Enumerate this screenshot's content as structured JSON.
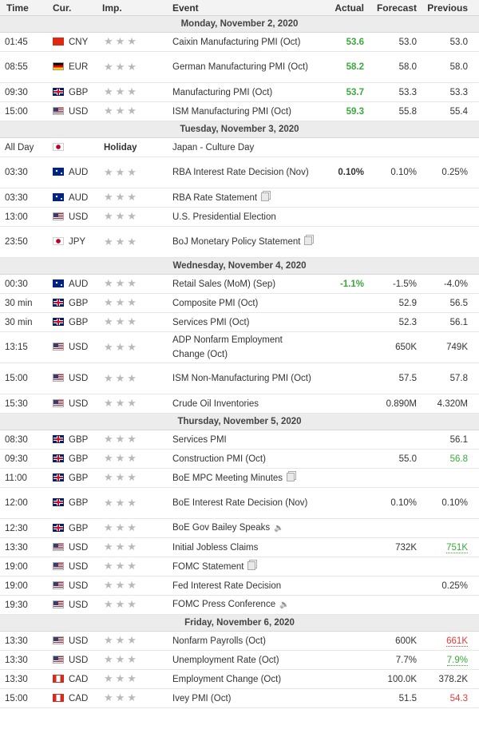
{
  "header": {
    "time": "Time",
    "currency": "Cur.",
    "importance": "Imp.",
    "event": "Event",
    "actual": "Actual",
    "forecast": "Forecast",
    "previous": "Previous"
  },
  "stars": "★★★",
  "colors": {
    "positive": "#3aa93a",
    "negative": "#e23b3b",
    "day_row_bg": "#ececec",
    "header_bg": "#f3f3f3"
  },
  "days": [
    {
      "label": "Monday, November 2, 2020",
      "events": [
        {
          "time": "01:45",
          "flag": "cn",
          "currency": "CNY",
          "event": "Caixin Manufacturing PMI (Oct)",
          "actual": "53.6",
          "actual_color": "green",
          "forecast": "53.0",
          "previous": "53.0"
        },
        {
          "time": "08:55",
          "flag": "de",
          "currency": "EUR",
          "event": "German Manufacturing PMI (Oct)",
          "actual": "58.2",
          "actual_color": "green",
          "forecast": "58.0",
          "previous": "58.0",
          "tall": true
        },
        {
          "time": "09:30",
          "flag": "gb",
          "currency": "GBP",
          "event": "Manufacturing PMI (Oct)",
          "actual": "53.7",
          "actual_color": "green",
          "forecast": "53.3",
          "previous": "53.3"
        },
        {
          "time": "15:00",
          "flag": "us",
          "currency": "USD",
          "event": "ISM Manufacturing PMI (Oct)",
          "actual": "59.3",
          "actual_color": "green",
          "forecast": "55.8",
          "previous": "55.4"
        }
      ]
    },
    {
      "label": "Tuesday, November 3, 2020",
      "events": [
        {
          "time": "All Day",
          "flag": "jp",
          "currency": "",
          "holiday": "Holiday",
          "event": "Japan - Culture Day",
          "actual": "",
          "forecast": "",
          "previous": ""
        },
        {
          "time": "03:30",
          "flag": "au",
          "currency": "AUD",
          "event": "RBA Interest Rate Decision (Nov)",
          "actual": "0.10%",
          "actual_color": "",
          "forecast": "0.10%",
          "previous": "0.25%",
          "tall": true
        },
        {
          "time": "03:30",
          "flag": "au",
          "currency": "AUD",
          "event": "RBA Rate Statement",
          "icon": "doc",
          "actual": "",
          "forecast": "",
          "previous": ""
        },
        {
          "time": "13:00",
          "flag": "us",
          "currency": "USD",
          "event": "U.S. Presidential Election",
          "actual": "",
          "forecast": "",
          "previous": ""
        },
        {
          "time": "23:50",
          "flag": "jp",
          "currency": "JPY",
          "event": "BoJ Monetary Policy Statement",
          "icon": "doc",
          "actual": "",
          "forecast": "",
          "previous": "",
          "tall": true
        }
      ]
    },
    {
      "label": "Wednesday, November 4, 2020",
      "events": [
        {
          "time": "00:30",
          "flag": "au",
          "currency": "AUD",
          "event": "Retail Sales (MoM) (Sep)",
          "actual": "-1.1%",
          "actual_color": "green",
          "forecast": "-1.5%",
          "previous": "-4.0%"
        },
        {
          "time": "30 min",
          "flag": "gb",
          "currency": "GBP",
          "event": "Composite PMI (Oct)",
          "actual": "",
          "forecast": "52.9",
          "previous": "56.5"
        },
        {
          "time": "30 min",
          "flag": "gb",
          "currency": "GBP",
          "event": "Services PMI (Oct)",
          "actual": "",
          "forecast": "52.3",
          "previous": "56.1"
        },
        {
          "time": "13:15",
          "flag": "us",
          "currency": "USD",
          "event": "ADP Nonfarm Employment Change (Oct)",
          "actual": "",
          "forecast": "650K",
          "previous": "749K",
          "tall": true
        },
        {
          "time": "15:00",
          "flag": "us",
          "currency": "USD",
          "event": "ISM Non-Manufacturing PMI (Oct)",
          "actual": "",
          "forecast": "57.5",
          "previous": "57.8",
          "tall": true
        },
        {
          "time": "15:30",
          "flag": "us",
          "currency": "USD",
          "event": "Crude Oil Inventories",
          "actual": "",
          "forecast": "0.890M",
          "previous": "4.320M"
        }
      ]
    },
    {
      "label": "Thursday, November 5, 2020",
      "events": [
        {
          "time": "08:30",
          "flag": "gb",
          "currency": "GBP",
          "event": "Services PMI",
          "actual": "",
          "forecast": "",
          "previous": "56.1"
        },
        {
          "time": "09:30",
          "flag": "gb",
          "currency": "GBP",
          "event": "Construction PMI (Oct)",
          "actual": "",
          "forecast": "55.0",
          "previous": "56.8",
          "previous_color": "green"
        },
        {
          "time": "11:00",
          "flag": "gb",
          "currency": "GBP",
          "event": "BoE MPC Meeting Minutes",
          "icon": "doc",
          "actual": "",
          "forecast": "",
          "previous": ""
        },
        {
          "time": "12:00",
          "flag": "gb",
          "currency": "GBP",
          "event": "BoE Interest Rate Decision (Nov)",
          "actual": "",
          "forecast": "0.10%",
          "previous": "0.10%",
          "tall": true
        },
        {
          "time": "12:30",
          "flag": "gb",
          "currency": "GBP",
          "event": "BoE Gov Bailey Speaks",
          "icon": "speaker",
          "actual": "",
          "forecast": "",
          "previous": ""
        },
        {
          "time": "13:30",
          "flag": "us",
          "currency": "USD",
          "event": "Initial Jobless Claims",
          "actual": "",
          "forecast": "732K",
          "previous": "751K",
          "previous_color": "green",
          "previous_dotted": true
        },
        {
          "time": "19:00",
          "flag": "us",
          "currency": "USD",
          "event": "FOMC Statement",
          "icon": "doc",
          "actual": "",
          "forecast": "",
          "previous": ""
        },
        {
          "time": "19:00",
          "flag": "us",
          "currency": "USD",
          "event": "Fed Interest Rate Decision",
          "actual": "",
          "forecast": "",
          "previous": "0.25%"
        },
        {
          "time": "19:30",
          "flag": "us",
          "currency": "USD",
          "event": "FOMC Press Conference",
          "icon": "speaker",
          "actual": "",
          "forecast": "",
          "previous": ""
        }
      ]
    },
    {
      "label": "Friday, November 6, 2020",
      "events": [
        {
          "time": "13:30",
          "flag": "us",
          "currency": "USD",
          "event": "Nonfarm Payrolls (Oct)",
          "actual": "",
          "forecast": "600K",
          "previous": "661K",
          "previous_color": "red",
          "previous_dotted": true
        },
        {
          "time": "13:30",
          "flag": "us",
          "currency": "USD",
          "event": "Unemployment Rate (Oct)",
          "actual": "",
          "forecast": "7.7%",
          "previous": "7.9%",
          "previous_color": "green",
          "previous_dotted": true
        },
        {
          "time": "13:30",
          "flag": "ca",
          "currency": "CAD",
          "event": "Employment Change (Oct)",
          "actual": "",
          "forecast": "100.0K",
          "previous": "378.2K"
        },
        {
          "time": "15:00",
          "flag": "ca",
          "currency": "CAD",
          "event": "Ivey PMI (Oct)",
          "actual": "",
          "forecast": "51.5",
          "previous": "54.3",
          "previous_color": "red"
        }
      ]
    }
  ]
}
